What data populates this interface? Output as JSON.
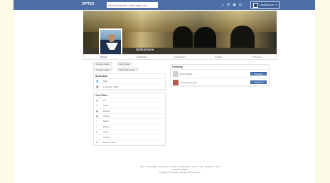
{
  "topbar": {
    "logo": "OPTEX",
    "search_placeholder": "Search for people, hosts, pages and ...",
    "icons": [
      "home-icon",
      "messages-icon",
      "notifications-icon",
      "friends-icon"
    ],
    "username": "UddhavGore"
  },
  "profile": {
    "name": "UddhavGore",
    "tabs": [
      {
        "label": "1 Posts"
      },
      {
        "label": "2 Following"
      },
      {
        "label": "2 Followers"
      },
      {
        "label": "0 Likes"
      },
      {
        "label": "0 Groups"
      }
    ]
  },
  "actions": {
    "change_cover": "Change cover",
    "edit_profile": "Edit Profile",
    "change_cover_2": "Change cover",
    "reposition_cover": "Reposition cover"
  },
  "about": {
    "title": "About Bulb",
    "rows": [
      {
        "icon": "user-icon",
        "label": "Male"
      },
      {
        "icon": "calendar-icon",
        "label": "1 January, 1994"
      }
    ]
  },
  "your_filters": {
    "title": "Your Filters",
    "items": [
      {
        "icon": "all-icon",
        "label": "All"
      },
      {
        "icon": "text-icon",
        "label": "Texts"
      },
      {
        "icon": "photos-icon",
        "label": "Photos"
      },
      {
        "icon": "videos-icon",
        "label": "Videos"
      },
      {
        "icon": "music-icon",
        "label": "Music"
      },
      {
        "icon": "places-icon",
        "label": "Places"
      },
      {
        "icon": "likes-icon",
        "label": "Likes"
      },
      {
        "icon": "shares-icon",
        "label": "Shares"
      },
      {
        "icon": "recent-icon",
        "label": "Recent Ofters"
      }
    ]
  },
  "following": {
    "title": "Following",
    "items": [
      {
        "name": "Helen Stefan",
        "button": "Following"
      },
      {
        "name": "Prachi Deshmukh",
        "button": "Following"
      }
    ]
  },
  "footer": {
    "links": "About · Create Page · Create Group · Contact · Privacy Policy · Terms of Use · Disclaimer · Admin",
    "language": "Language: English",
    "copyright": "Copyright © 2015 Optex. All rights reserved Optex."
  }
}
